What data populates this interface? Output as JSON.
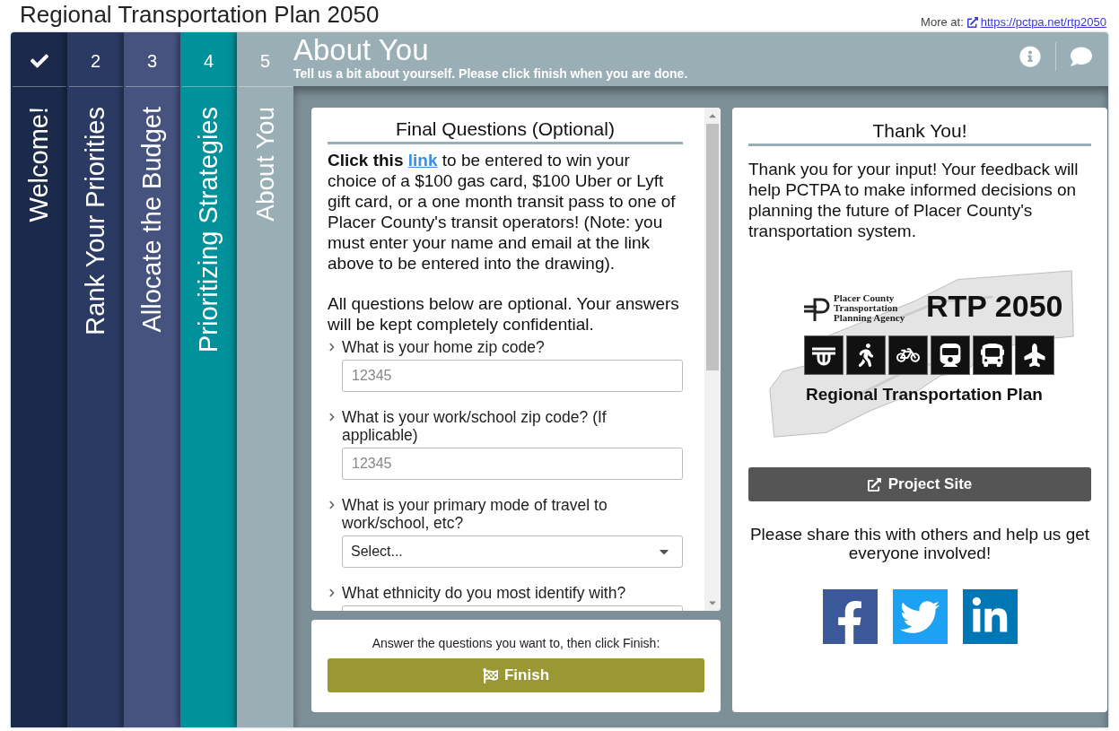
{
  "page_title": "Regional Transportation Plan 2050",
  "more_at": {
    "label": "More at:",
    "url": "https://pctpa.net/rtp2050"
  },
  "tabs": [
    {
      "kind": "done",
      "label": "Welcome!",
      "color": "#1b2a4a",
      "selected": false
    },
    {
      "kind": "step",
      "marker": "2",
      "label": "Rank Your Priorities",
      "color": "#2b3a62",
      "selected": false
    },
    {
      "kind": "step",
      "marker": "3",
      "label": "Allocate the Budget",
      "color": "#45537e",
      "selected": false
    },
    {
      "kind": "step",
      "marker": "4",
      "label": "Prioritizing Strategies",
      "color": "#00919a",
      "selected": false
    },
    {
      "kind": "step",
      "marker": "5",
      "label": "About You",
      "color": "#9aaeb5",
      "selected": true
    }
  ],
  "header": {
    "title": "About You",
    "subtitle": "Tell us a bit about yourself. Please click finish when you are done."
  },
  "questions_panel": {
    "title": "Final Questions (Optional)",
    "intro": {
      "lead": "Click this",
      "link": "link",
      "rest": "to be entered to win your choice of a $100 gas card, $100 Uber or Lyft gift card, or a one month transit pass to one of Placer County's transit operators! (Note: you must enter your name and email at the link above to be entered into the drawing)."
    },
    "note": "All questions below are optional. Your answers will be kept completely confidential.",
    "questions": [
      {
        "kind": "text",
        "label": "What is your home zip code?",
        "placeholder": "12345"
      },
      {
        "kind": "text",
        "label": "What is your work/school zip code? (If applicable)",
        "placeholder": "12345"
      },
      {
        "kind": "select",
        "label": "What is your primary mode of travel to work/school, etc?",
        "value": "Select..."
      },
      {
        "kind": "select",
        "label": "What ethnicity do you most identify with?"
      }
    ]
  },
  "finish_panel": {
    "prompt": "Answer the questions you want to, then click Finish:",
    "button": "Finish"
  },
  "thanks_panel": {
    "title": "Thank You!",
    "message": "Thank you for your input! Your feedback will help PCTPA to make informed decisions on planning the future of Placer County's transportation system.",
    "logo": {
      "agency": "Placer County Transportation Planning Agency",
      "title": "RTP 2050",
      "subtitle": "Regional Transportation Plan",
      "modes": [
        {
          "kind": "road"
        },
        {
          "kind": "walk"
        },
        {
          "kind": "bike"
        },
        {
          "kind": "train"
        },
        {
          "kind": "bus"
        },
        {
          "kind": "plane"
        }
      ]
    },
    "project_button": "Project Site",
    "share_text": "Please share this with others and help us get everyone involved!",
    "social": [
      {
        "kind": "facebook",
        "color": "#3b5998"
      },
      {
        "kind": "twitter",
        "color": "#1da1f2"
      },
      {
        "kind": "linkedin",
        "color": "#0077b5"
      }
    ]
  }
}
